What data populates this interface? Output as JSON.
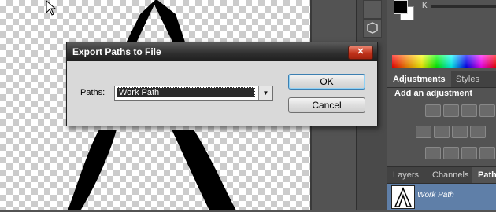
{
  "dialog": {
    "title": "Export Paths to File",
    "paths_label": "Paths:",
    "paths_value": "Work Path",
    "ok_label": "OK",
    "cancel_label": "Cancel",
    "close_symbol": "✕"
  },
  "color_panel": {
    "k_label": "K",
    "foreground_color": "#000000",
    "background_color": "#ffffff"
  },
  "adjustments_panel": {
    "tabs": [
      {
        "label": "Adjustments",
        "active": true
      },
      {
        "label": "Styles",
        "active": false
      }
    ],
    "heading": "Add an adjustment"
  },
  "layers_panel": {
    "tabs": [
      {
        "label": "Layers",
        "active": false
      },
      {
        "label": "Channels",
        "active": false
      },
      {
        "label": "Path",
        "active": true
      }
    ],
    "paths": [
      {
        "name": "Work Path",
        "selected": true
      }
    ]
  },
  "icons": [
    "arrow-cursor-icon",
    "close-icon",
    "dropdown-arrow-icon",
    "brightness-icon",
    "levels-icon",
    "curves-icon",
    "exposure-icon",
    "vibrance-icon",
    "balance-icon",
    "path-thumbnail-icon"
  ]
}
